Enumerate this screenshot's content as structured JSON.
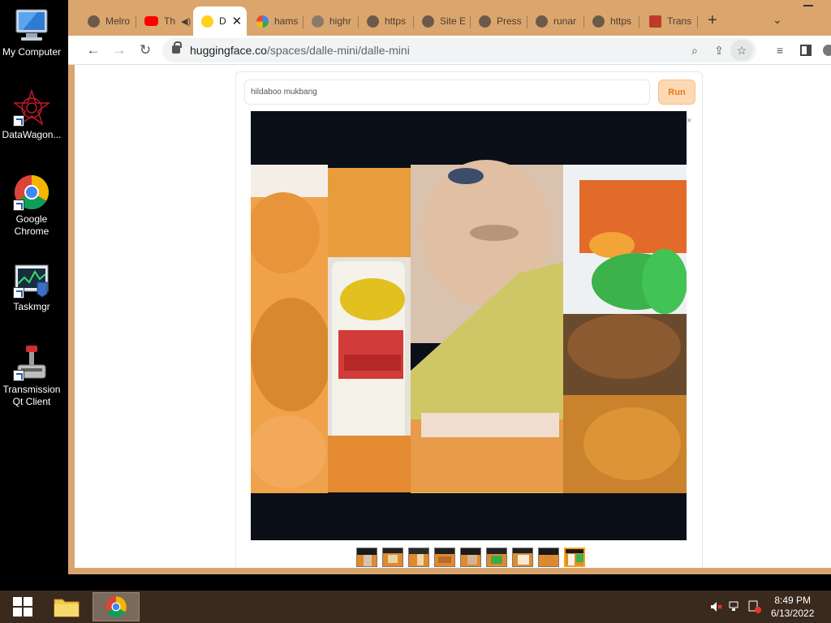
{
  "desktop": {
    "icons": [
      {
        "label": "My Computer",
        "icon": "computer-icon"
      },
      {
        "label": "DataWagon...",
        "icon": "datawagon-icon"
      },
      {
        "label": "Google\nChrome",
        "icon": "chrome-icon"
      },
      {
        "label": "Taskmgr",
        "icon": "taskmgr-icon"
      },
      {
        "label": "Transmission\nQt Client",
        "icon": "transmission-icon"
      }
    ]
  },
  "browser": {
    "tabs": [
      {
        "title": "Melro",
        "favicon": "globe-icon"
      },
      {
        "title": "Th",
        "favicon": "youtube-icon"
      },
      {
        "title": "D",
        "favicon": "huggingface-icon",
        "active": true
      },
      {
        "title": "hams",
        "favicon": "google-icon"
      },
      {
        "title": "highr",
        "favicon": "globe-icon"
      },
      {
        "title": "https",
        "favicon": "globe-icon"
      },
      {
        "title": "Site E",
        "favicon": "globe-icon"
      },
      {
        "title": "Press",
        "favicon": "globe-icon"
      },
      {
        "title": "runar",
        "favicon": "globe-icon"
      },
      {
        "title": "https",
        "favicon": "globe-icon"
      },
      {
        "title": "Trans",
        "favicon": "transmission-icon"
      }
    ],
    "url_host": "huggingface.co",
    "url_path": "/spaces/dalle-mini/dalle-mini",
    "accent": "#dba66e"
  },
  "app": {
    "prompt_value": "hildaboo mukbang",
    "run_label": "Run",
    "close_label": "×",
    "thumbnail_count": 9,
    "selected_thumbnail": 9
  },
  "taskbar": {
    "time": "8:49 PM",
    "date": "6/13/2022"
  }
}
